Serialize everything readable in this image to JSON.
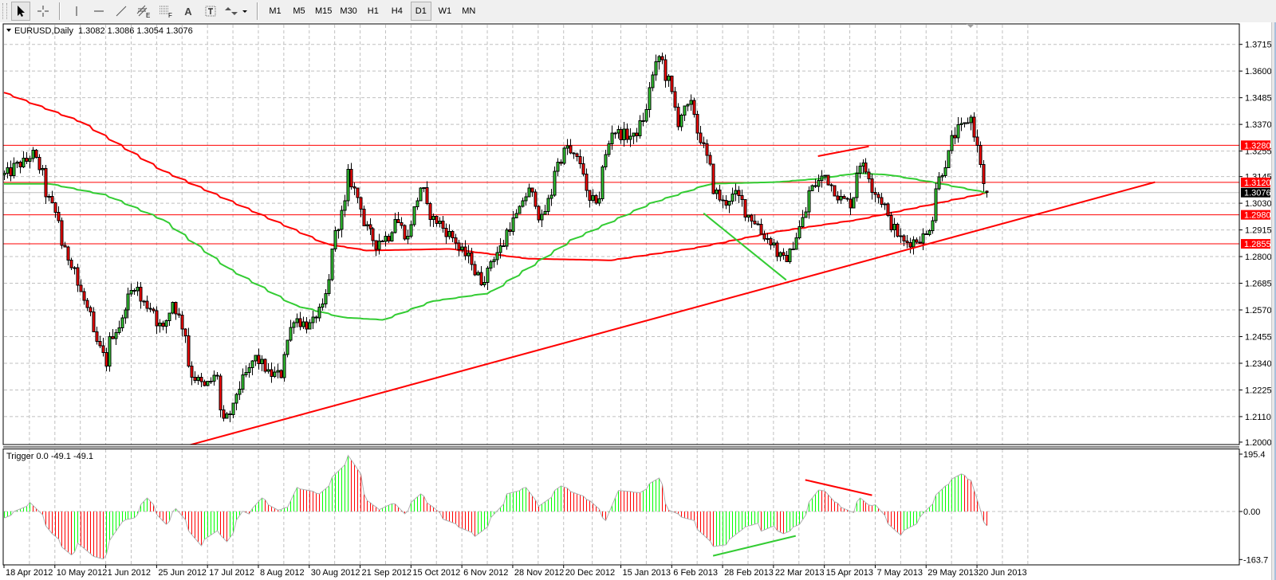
{
  "toolbar": {
    "tools": [
      {
        "name": "cursor",
        "active": true
      },
      {
        "name": "crosshair",
        "active": false
      },
      {
        "name": "vertical-line",
        "active": false
      },
      {
        "name": "horizontal-line",
        "active": false
      },
      {
        "name": "trendline",
        "active": false
      },
      {
        "name": "equidistant-channel",
        "active": false,
        "sub": "E"
      },
      {
        "name": "fibonacci",
        "active": false,
        "sub": "F"
      },
      {
        "name": "text",
        "active": false,
        "label": "A"
      },
      {
        "name": "text-label",
        "active": false,
        "label": "T"
      },
      {
        "name": "arrows",
        "active": false
      }
    ],
    "timeframes": [
      "M1",
      "M5",
      "M15",
      "M30",
      "H1",
      "H4",
      "D1",
      "W1",
      "MN"
    ],
    "active_timeframe": "D1"
  },
  "chart": {
    "symbol_title": "EURUSD,Daily",
    "ohlc": "1.3082 1.3086 1.3054 1.3076"
  },
  "indicator": {
    "title": "Trigger 0.0 -49.1 -49.1",
    "axis_labels": [
      "195.4",
      "0.00",
      "-163.7"
    ]
  },
  "colors": {
    "bull": "#32cd32",
    "bear": "#ff0000",
    "hist_up": "#00ff00",
    "hist_down": "#ff0000",
    "ma_slow": "#ff0000",
    "ma_fast": "#33cc33",
    "level": "#ff0000",
    "current_price": "#000000",
    "grid": "#c0c0c0"
  },
  "chart_data": [
    {
      "type": "candlestick",
      "symbol": "EURUSD",
      "timeframe": "Daily",
      "ylim": [
        1.2,
        1.3715
      ],
      "y_tick_labels": [
        "1.3715",
        "1.3600",
        "1.3485",
        "1.3370",
        "1.3255",
        "1.3145",
        "1.3030",
        "1.2915",
        "1.2800",
        "1.2685",
        "1.2570",
        "1.2455",
        "1.2340",
        "1.2225",
        "1.2110",
        "1.2000"
      ],
      "x_tick_labels": [
        "18 Apr 2012",
        "10 May 2012",
        "1 Jun 2012",
        "25 Jun 2012",
        "17 Jul 2012",
        "8 Aug 2012",
        "30 Aug 2012",
        "21 Sep 2012",
        "15 Oct 2012",
        "6 Nov 2012",
        "28 Nov 2012",
        "20 Dec 2012",
        "15 Jan 2013",
        "6 Feb 2013",
        "28 Feb 2013",
        "22 Mar 2013",
        "15 Apr 2013",
        "7 May 2013",
        "29 May 2013",
        "20 Jun 2013"
      ],
      "x_tick_dates": [
        "2012-04-18",
        "2012-05-10",
        "2012-06-01",
        "2012-06-25",
        "2012-07-17",
        "2012-08-08",
        "2012-08-30",
        "2012-09-21",
        "2012-10-15",
        "2012-11-06",
        "2012-11-28",
        "2012-12-20",
        "2013-01-15",
        "2013-02-06",
        "2013-02-28",
        "2013-03-22",
        "2013-04-15",
        "2013-05-07",
        "2013-05-29",
        "2013-06-20"
      ],
      "grid": true,
      "first_date": "2012-04-18",
      "last_date": "2013-06-25",
      "last_bar": {
        "open": 1.3082,
        "high": 1.3086,
        "low": 1.3054,
        "close": 1.3076
      },
      "close_path": [
        [
          "2012-04-18",
          1.3152
        ],
        [
          "2012-05-01",
          1.324
        ],
        [
          "2012-05-06",
          1.31
        ],
        [
          "2012-05-11",
          1.2959
        ],
        [
          "2012-05-15",
          1.2819
        ],
        [
          "2012-05-20",
          1.2713
        ],
        [
          "2012-05-25",
          1.2538
        ],
        [
          "2012-06-01",
          1.2344
        ],
        [
          "2012-06-05",
          1.2467
        ],
        [
          "2012-06-09",
          1.2538
        ],
        [
          "2012-06-14",
          1.2678
        ],
        [
          "2012-06-18",
          1.2608
        ],
        [
          "2012-06-22",
          1.2573
        ],
        [
          "2012-06-27",
          1.2485
        ],
        [
          "2012-07-01",
          1.2643
        ],
        [
          "2012-07-06",
          1.2467
        ],
        [
          "2012-07-10",
          1.2292
        ],
        [
          "2012-07-15",
          1.2221
        ],
        [
          "2012-07-20",
          1.2292
        ],
        [
          "2012-07-24",
          1.2081
        ],
        [
          "2012-07-29",
          1.2186
        ],
        [
          "2012-08-02",
          1.2292
        ],
        [
          "2012-08-07",
          1.2362
        ],
        [
          "2012-08-12",
          1.2292
        ],
        [
          "2012-08-18",
          1.2292
        ],
        [
          "2012-08-23",
          1.2538
        ],
        [
          "2012-08-30",
          1.2502
        ],
        [
          "2012-09-05",
          1.2573
        ],
        [
          "2012-09-08",
          1.2748
        ],
        [
          "2012-09-12",
          1.2942
        ],
        [
          "2012-09-17",
          1.3152
        ],
        [
          "2012-09-23",
          1.2959
        ],
        [
          "2012-09-28",
          1.2854
        ],
        [
          "2012-10-04",
          1.2889
        ],
        [
          "2012-10-07",
          1.2994
        ],
        [
          "2012-10-13",
          1.2854
        ],
        [
          "2012-10-18",
          1.31
        ],
        [
          "2012-10-24",
          1.2959
        ],
        [
          "2012-10-29",
          1.2924
        ],
        [
          "2012-11-03",
          1.2854
        ],
        [
          "2012-11-09",
          1.2784
        ],
        [
          "2012-11-14",
          1.2696
        ],
        [
          "2012-11-19",
          1.2784
        ],
        [
          "2012-11-25",
          1.2889
        ],
        [
          "2012-11-30",
          1.2994
        ],
        [
          "2012-12-05",
          1.3082
        ],
        [
          "2012-12-11",
          1.2959
        ],
        [
          "2012-12-16",
          1.3152
        ],
        [
          "2012-12-21",
          1.3275
        ],
        [
          "2012-12-27",
          1.3205
        ],
        [
          "2013-01-01",
          1.303
        ],
        [
          "2013-01-05",
          1.3065
        ],
        [
          "2013-01-10",
          1.3345
        ],
        [
          "2013-01-15",
          1.3328
        ],
        [
          "2013-01-21",
          1.3311
        ],
        [
          "2013-01-26",
          1.3451
        ],
        [
          "2013-01-31",
          1.3662
        ],
        [
          "2013-02-05",
          1.3557
        ],
        [
          "2013-02-08",
          1.3381
        ],
        [
          "2013-02-14",
          1.3451
        ],
        [
          "2013-02-19",
          1.3311
        ],
        [
          "2013-02-23",
          1.3135
        ],
        [
          "2013-02-28",
          1.303
        ],
        [
          "2013-03-06",
          1.3065
        ],
        [
          "2013-03-11",
          1.2994
        ],
        [
          "2013-03-16",
          1.2924
        ],
        [
          "2013-03-22",
          1.2854
        ],
        [
          "2013-03-27",
          1.2784
        ],
        [
          "2013-04-01",
          1.2854
        ],
        [
          "2013-04-07",
          1.3065
        ],
        [
          "2013-04-14",
          1.317
        ],
        [
          "2013-04-19",
          1.3065
        ],
        [
          "2013-04-25",
          1.303
        ],
        [
          "2013-04-30",
          1.3205
        ],
        [
          "2013-05-06",
          1.31
        ],
        [
          "2013-05-13",
          1.2959
        ],
        [
          "2013-05-18",
          1.2854
        ],
        [
          "2013-05-24",
          1.2872
        ],
        [
          "2013-05-29",
          1.2889
        ],
        [
          "2013-06-03",
          1.31
        ],
        [
          "2013-06-07",
          1.324
        ],
        [
          "2013-06-12",
          1.3345
        ],
        [
          "2013-06-18",
          1.3398
        ],
        [
          "2013-06-21",
          1.3205
        ],
        [
          "2013-06-25",
          1.3076
        ]
      ],
      "moving_averages": [
        {
          "color": "#ff0000",
          "points": [
            [
              "2012-04-18",
              1.3507
            ],
            [
              "2012-05-22",
              1.3381
            ],
            [
              "2012-06-27",
              1.317
            ],
            [
              "2012-08-02",
              1.3012
            ],
            [
              "2012-09-07",
              1.2854
            ],
            [
              "2012-09-25",
              1.2826
            ],
            [
              "2012-10-31",
              1.2833
            ],
            [
              "2012-12-05",
              1.2791
            ],
            [
              "2013-01-10",
              1.2784
            ],
            [
              "2013-02-16",
              1.2836
            ],
            [
              "2013-03-24",
              1.2907
            ],
            [
              "2013-04-29",
              1.2959
            ],
            [
              "2013-06-03",
              1.303
            ],
            [
              "2013-06-25",
              1.3075
            ]
          ]
        },
        {
          "color": "#33cc33",
          "points": [
            [
              "2012-04-18",
              1.3114
            ],
            [
              "2012-05-08",
              1.3114
            ],
            [
              "2012-06-02",
              1.3065
            ],
            [
              "2012-06-27",
              1.2959
            ],
            [
              "2012-07-26",
              1.2748
            ],
            [
              "2012-08-24",
              1.259
            ],
            [
              "2012-09-14",
              1.2538
            ],
            [
              "2012-10-02",
              1.2527
            ],
            [
              "2012-10-24",
              1.2608
            ],
            [
              "2012-11-18",
              1.2643
            ],
            [
              "2012-12-24",
              1.2871
            ],
            [
              "2013-01-28",
              1.303
            ],
            [
              "2013-02-23",
              1.3114
            ],
            [
              "2013-03-24",
              1.3121
            ],
            [
              "2013-04-11",
              1.3135
            ],
            [
              "2013-04-29",
              1.316
            ],
            [
              "2013-05-13",
              1.3152
            ],
            [
              "2013-06-03",
              1.3117
            ],
            [
              "2013-06-25",
              1.3075
            ]
          ]
        }
      ],
      "horizontal_levels": [
        {
          "price": 1.328,
          "label": "1.3280"
        },
        {
          "price": 1.312,
          "label": "1.3120"
        },
        {
          "price": 1.298,
          "label": "1.2980"
        },
        {
          "price": 1.2855,
          "label": "1.2855"
        }
      ],
      "current_price": {
        "price": 1.3076,
        "label": "1.3076"
      },
      "trendlines": [
        {
          "color": "#ff0000",
          "from": [
            "2012-07-09",
            1.1986
          ],
          "to": [
            "2013-09-06",
            1.3121
          ]
        },
        {
          "color": "#ff0000",
          "from": [
            "2013-04-11",
            1.3233
          ],
          "to": [
            "2013-05-03",
            1.3275
          ]
        },
        {
          "color": "#33cc33",
          "from": [
            "2013-02-20",
            1.2987
          ],
          "to": [
            "2013-03-28",
            1.2699
          ]
        }
      ]
    },
    {
      "type": "histogram",
      "name": "Trigger",
      "ylim": [
        -163.7,
        195.4
      ],
      "y_tick_labels": [
        "195.4",
        "0.00",
        "-163.7"
      ],
      "values_path": [
        [
          "2012-04-18",
          -22
        ],
        [
          "2012-04-30",
          31
        ],
        [
          "2012-05-05",
          -22
        ],
        [
          "2012-05-09",
          -76
        ],
        [
          "2012-05-17",
          -148
        ],
        [
          "2012-05-21",
          -108
        ],
        [
          "2012-05-25",
          -144
        ],
        [
          "2012-05-31",
          -162
        ],
        [
          "2012-06-08",
          -35
        ],
        [
          "2012-06-14",
          -22
        ],
        [
          "2012-06-20",
          46
        ],
        [
          "2012-06-28",
          -44
        ],
        [
          "2012-07-03",
          10
        ],
        [
          "2012-07-13",
          -117
        ],
        [
          "2012-07-21",
          -58
        ],
        [
          "2012-07-25",
          -103
        ],
        [
          "2012-08-01",
          1
        ],
        [
          "2012-08-04",
          -13
        ],
        [
          "2012-08-09",
          46
        ],
        [
          "2012-08-16",
          5
        ],
        [
          "2012-08-21",
          14
        ],
        [
          "2012-08-24",
          82
        ],
        [
          "2012-08-29",
          73
        ],
        [
          "2012-09-04",
          60
        ],
        [
          "2012-09-08",
          96
        ],
        [
          "2012-09-17",
          191
        ],
        [
          "2012-09-21",
          128
        ],
        [
          "2012-09-25",
          37
        ],
        [
          "2012-09-30",
          1
        ],
        [
          "2012-10-07",
          37
        ],
        [
          "2012-10-11",
          -8
        ],
        [
          "2012-10-18",
          60
        ],
        [
          "2012-10-24",
          14
        ],
        [
          "2012-10-28",
          -22
        ],
        [
          "2012-11-06",
          -58
        ],
        [
          "2012-11-12",
          -85
        ],
        [
          "2012-11-17",
          -44
        ],
        [
          "2012-11-26",
          60
        ],
        [
          "2012-12-04",
          82
        ],
        [
          "2012-12-09",
          10
        ],
        [
          "2012-12-19",
          87
        ],
        [
          "2013-01-01",
          37
        ],
        [
          "2013-01-08",
          -31
        ],
        [
          "2013-01-12",
          73
        ],
        [
          "2013-01-23",
          64
        ],
        [
          "2013-01-31",
          114
        ],
        [
          "2013-02-05",
          5
        ],
        [
          "2013-02-09",
          -13
        ],
        [
          "2013-02-15",
          -31
        ],
        [
          "2013-02-24",
          -121
        ],
        [
          "2013-03-02",
          -112
        ],
        [
          "2013-03-08",
          -62
        ],
        [
          "2013-03-15",
          -40
        ],
        [
          "2013-03-18",
          -67
        ],
        [
          "2013-03-22",
          -49
        ],
        [
          "2013-03-27",
          -76
        ],
        [
          "2013-04-03",
          -44
        ],
        [
          "2013-04-06",
          5
        ],
        [
          "2013-04-11",
          73
        ],
        [
          "2013-04-15",
          69
        ],
        [
          "2013-04-18",
          33
        ],
        [
          "2013-04-26",
          -4
        ],
        [
          "2013-04-30",
          46
        ],
        [
          "2013-05-04",
          14
        ],
        [
          "2013-05-07",
          23
        ],
        [
          "2013-05-10",
          -13
        ],
        [
          "2013-05-17",
          -81
        ],
        [
          "2013-05-26",
          -31
        ],
        [
          "2013-05-29",
          5
        ],
        [
          "2013-06-06",
          87
        ],
        [
          "2013-06-13",
          128
        ],
        [
          "2013-06-18",
          106
        ],
        [
          "2013-06-21",
          5
        ],
        [
          "2013-06-25",
          -49.1
        ]
      ],
      "trendlines": [
        {
          "color": "#ff0000",
          "from": [
            "2013-04-05",
            107.6
          ],
          "to": [
            "2013-05-06",
            55.2
          ]
        },
        {
          "color": "#33cc33",
          "from": [
            "2013-02-24",
            -151
          ],
          "to": [
            "2013-04-02",
            -83.2
          ]
        }
      ]
    }
  ]
}
